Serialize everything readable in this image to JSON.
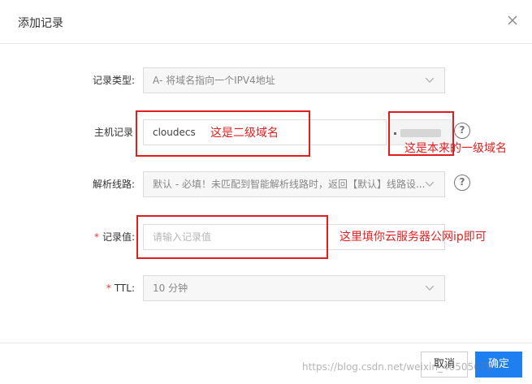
{
  "dialog": {
    "title": "添加记录"
  },
  "form": {
    "record_type": {
      "label": "记录类型:",
      "value": "A- 将域名指向一个IPV4地址"
    },
    "host": {
      "label": "主机记录",
      "value": "cloudecs"
    },
    "line": {
      "label": "解析线路:",
      "value": "默认 - 必填！未匹配到智能解析线路时，返回【默认】线路设..."
    },
    "record_value": {
      "label": "记录值:",
      "required_mark": "*",
      "placeholder": "请输入记录值"
    },
    "ttl": {
      "label": "TTL:",
      "required_mark": "*",
      "value": "10 分钟"
    }
  },
  "annotations": {
    "host_note": "这是二级域名",
    "domain_note": "这是本来的一级域名",
    "value_note": "这里填你云服务器公网ip即可"
  },
  "footer": {
    "cancel_label": "取消",
    "ok_label": "确定"
  },
  "watermark": "https://blog.csdn.net/weixin_40505679",
  "colors": {
    "annotation": "#e01e1e",
    "primary": "#1e7ff0",
    "required": "#e4393c"
  }
}
